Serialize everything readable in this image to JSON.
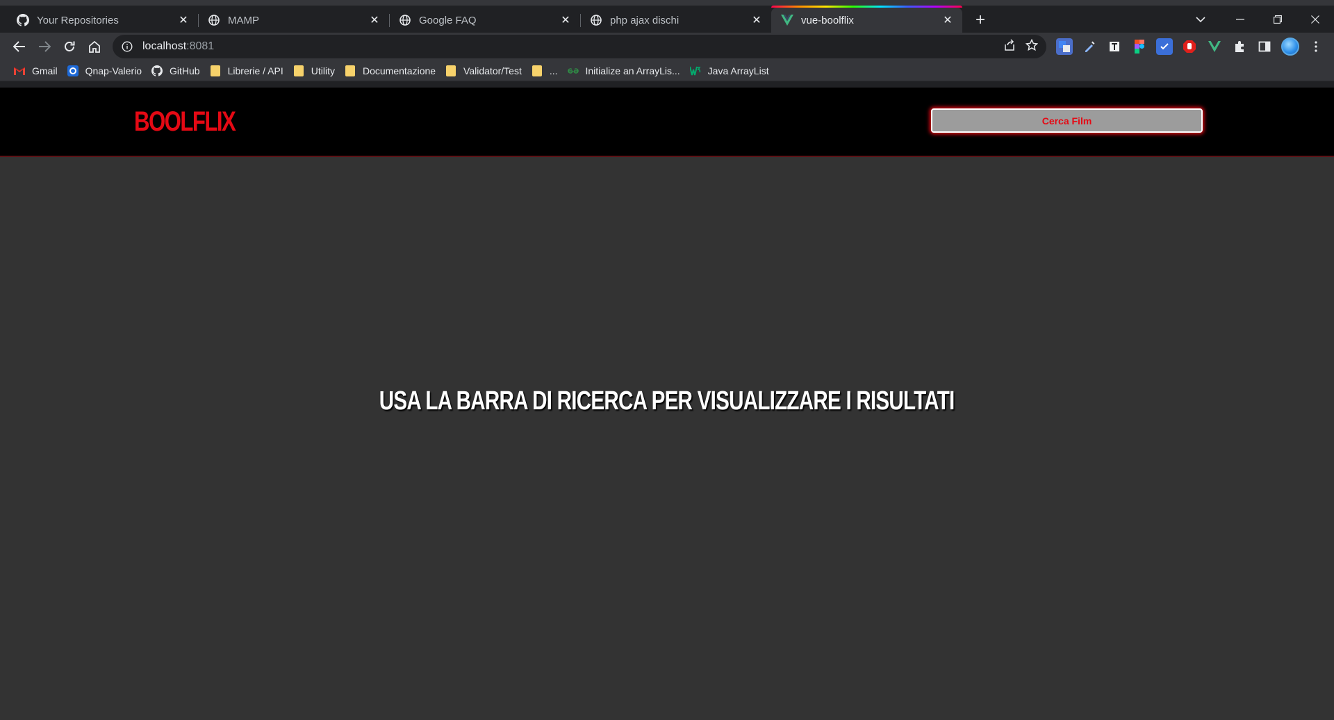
{
  "browser": {
    "tabs": [
      {
        "title": "Your Repositories",
        "icon": "github-icon",
        "active": false
      },
      {
        "title": "MAMP",
        "icon": "globe-icon",
        "active": false
      },
      {
        "title": "Google FAQ",
        "icon": "globe-icon",
        "active": false
      },
      {
        "title": "php ajax dischi",
        "icon": "globe-icon",
        "active": false
      },
      {
        "title": "vue-boolflix",
        "icon": "vue-icon",
        "active": true
      }
    ],
    "close_glyph": "✕",
    "new_tab_glyph": "+",
    "address": {
      "host": "localhost",
      "port": ":8081"
    },
    "bookmarks": [
      {
        "label": "Gmail",
        "icon": "gmail-icon"
      },
      {
        "label": "Qnap-Valerio",
        "icon": "qnap-icon"
      },
      {
        "label": "GitHub",
        "icon": "github-icon"
      },
      {
        "label": "Librerie / API",
        "icon": "folder-icon"
      },
      {
        "label": "Utility",
        "icon": "folder-icon"
      },
      {
        "label": "Documentazione",
        "icon": "folder-icon"
      },
      {
        "label": "Validator/Test",
        "icon": "folder-icon"
      },
      {
        "label": "...",
        "icon": "folder-icon"
      },
      {
        "label": "Initialize an ArrayLis...",
        "icon": "geeksforgeeks-icon"
      },
      {
        "label": "Java ArrayList",
        "icon": "w3schools-icon"
      }
    ]
  },
  "app": {
    "logo": "BOOLFLIX",
    "search_placeholder": "Cerca Film",
    "empty_message": "Usa la barra di ricerca per visualizzare i risultati",
    "colors": {
      "brand": "#e50914",
      "header_bg": "#000000",
      "page_bg": "#333333"
    }
  }
}
